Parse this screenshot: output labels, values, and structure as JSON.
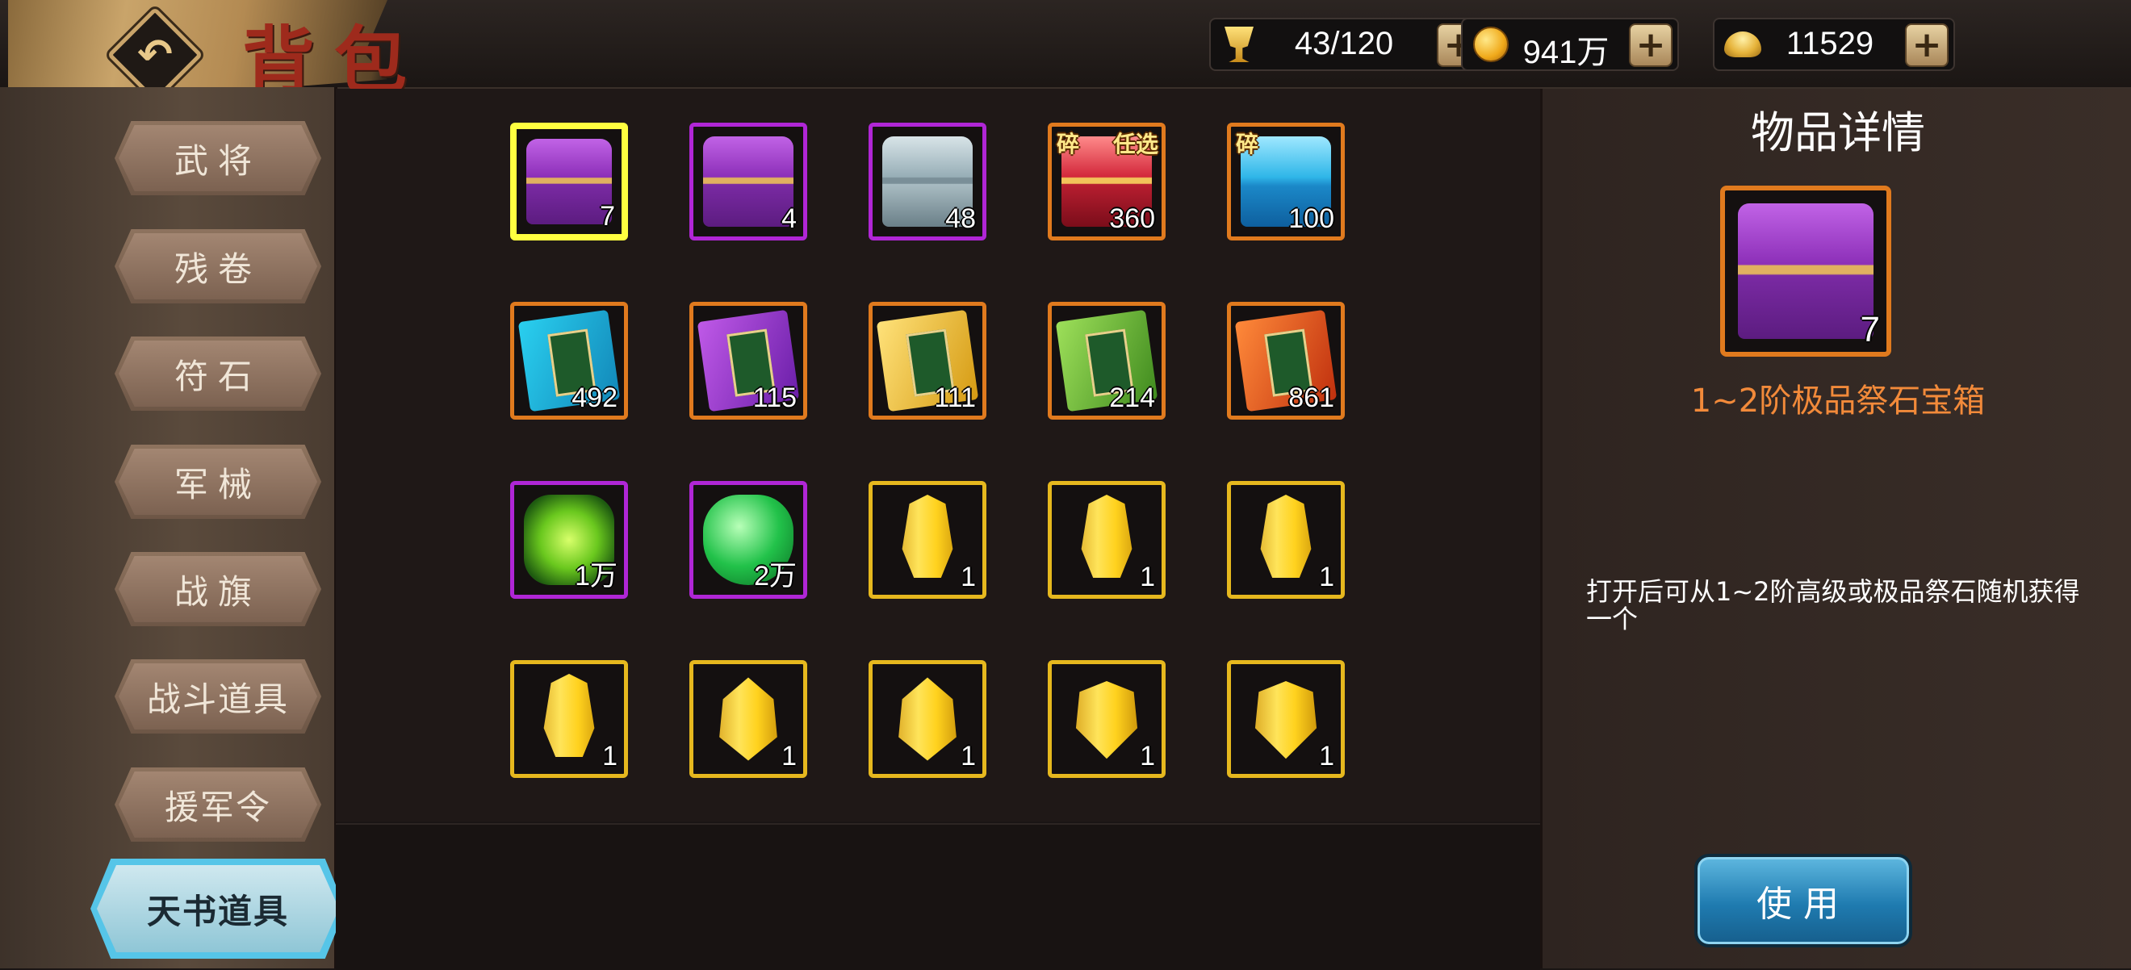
{
  "header": {
    "title": "背包",
    "resources": [
      {
        "icon": "trophy-icon",
        "value": "43/120"
      },
      {
        "icon": "gold-coin-icon",
        "value": "941万"
      },
      {
        "icon": "gold-ingot-icon",
        "value": "11529"
      }
    ]
  },
  "sidebar": {
    "items": [
      {
        "label": "武将"
      },
      {
        "label": "残卷"
      },
      {
        "label": "符石"
      },
      {
        "label": "军械"
      },
      {
        "label": "战旗"
      },
      {
        "label": "战斗道具"
      },
      {
        "label": "援军令"
      },
      {
        "label": "天书道具",
        "active": true
      }
    ]
  },
  "inventory": {
    "items": [
      {
        "icon": "purple-treasure-chest-icon",
        "count": "7",
        "quality": "yellow",
        "selected": true
      },
      {
        "icon": "purple-treasure-chest-icon",
        "count": "4",
        "quality": "purple"
      },
      {
        "icon": "silver-treasure-chest-icon",
        "count": "48",
        "quality": "purple"
      },
      {
        "icon": "red-heaven-chest-icon",
        "count": "360",
        "quality": "orange",
        "tags": [
          "碎",
          "任选"
        ]
      },
      {
        "icon": "blue-heaven-chest-icon",
        "count": "100",
        "quality": "orange",
        "tags": [
          "碎"
        ]
      },
      {
        "icon": "cyan-heavenly-book-icon",
        "count": "492",
        "quality": "orange"
      },
      {
        "icon": "purple-heavenly-book-icon",
        "count": "115",
        "quality": "orange"
      },
      {
        "icon": "yellow-heavenly-book-icon",
        "count": "111",
        "quality": "orange"
      },
      {
        "icon": "green-heavenly-book-icon",
        "count": "214",
        "quality": "orange"
      },
      {
        "icon": "red-heavenly-book-icon",
        "count": "861",
        "quality": "orange"
      },
      {
        "icon": "green-magic-book-icon",
        "count": "1万",
        "quality": "purple"
      },
      {
        "icon": "green-gem-book-icon",
        "count": "2万",
        "quality": "purple"
      },
      {
        "icon": "yellow-crystal-icon",
        "count": "1",
        "quality": "yellow"
      },
      {
        "icon": "yellow-crystal-icon",
        "count": "1",
        "quality": "yellow"
      },
      {
        "icon": "yellow-crystal-icon",
        "count": "1",
        "quality": "yellow"
      },
      {
        "icon": "yellow-crystal-icon",
        "count": "1",
        "quality": "yellow"
      },
      {
        "icon": "yellow-gem-icon",
        "count": "1",
        "quality": "yellow"
      },
      {
        "icon": "yellow-gem-icon",
        "count": "1",
        "quality": "yellow"
      },
      {
        "icon": "yellow-shield-gem-icon",
        "count": "1",
        "quality": "yellow"
      },
      {
        "icon": "yellow-shield-gem-icon",
        "count": "1",
        "quality": "yellow"
      }
    ]
  },
  "detail": {
    "heading": "物品详情",
    "icon": "purple-treasure-chest-icon",
    "count": "7",
    "name": "1~2阶极品祭石宝箱",
    "description": "打开后可从1~2阶高级或极品祭石随机获得一个",
    "use_label": "使用",
    "name_color": "#f28a3a"
  }
}
